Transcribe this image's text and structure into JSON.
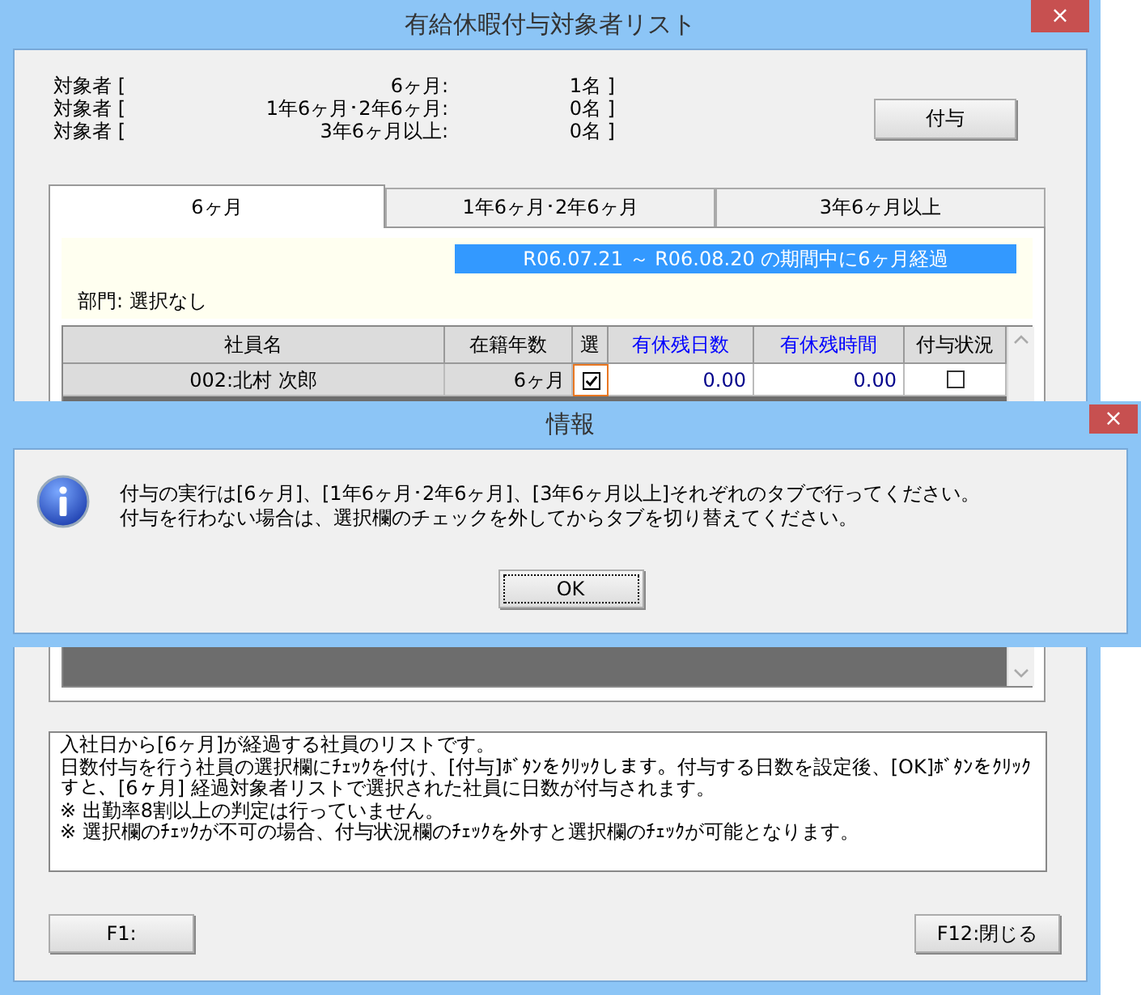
{
  "window": {
    "title": "有給休暇付与対象者リスト",
    "close": "×"
  },
  "summary": [
    {
      "prefix": "対象者 [",
      "label": "6ヶ月:",
      "count": "1名 ]"
    },
    {
      "prefix": "対象者 [",
      "label": "1年6ヶ月･2年6ヶ月:",
      "count": "0名 ]"
    },
    {
      "prefix": "対象者 [",
      "label": "3年6ヶ月以上:",
      "count": "0名 ]"
    }
  ],
  "grant_button": "付与",
  "tabs": [
    {
      "label": "6ヶ月",
      "selected": true
    },
    {
      "label": "1年6ヶ月･2年6ヶ月",
      "selected": false
    },
    {
      "label": "3年6ヶ月以上",
      "selected": false
    }
  ],
  "period_banner": "R06.07.21 ～ R06.08.20 の期間中に6ヶ月経過",
  "department": "部門:  選択なし",
  "table": {
    "columns": [
      {
        "label": "社員名",
        "color": "#000000"
      },
      {
        "label": "在籍年数",
        "color": "#000000"
      },
      {
        "label": "選",
        "color": "#000000"
      },
      {
        "label": "有休残日数",
        "color": "#0000ff"
      },
      {
        "label": "有休残時間",
        "color": "#0000ff"
      },
      {
        "label": "付与状況",
        "color": "#000000"
      }
    ],
    "rows": [
      {
        "name": "002:北村  次郎",
        "tenure": "6ヶ月",
        "checked": true,
        "focused": true,
        "days": "0.00",
        "hours": "0.00",
        "granted": false
      }
    ]
  },
  "description": [
    "入社日から[6ヶ月]が経過する社員のリストです。",
    "日数付与を行う社員の選択欄にﾁｪｯｸを付け、[付与]ﾎﾞﾀﾝをｸﾘｯｸします。付与する日数を設定後、[OK]ﾎﾞﾀﾝをｸﾘｯｸすと、[6ヶ月] 経過対象者リストで選択された社員に日数が付与されます。",
    "※ 出勤率8割以上の判定は行っていません。",
    "※ 選択欄のﾁｪｯｸが不可の場合、付与状況欄のﾁｪｯｸを外すと選択欄のﾁｪｯｸが可能となります。"
  ],
  "footer_buttons": [
    "F1:",
    "F12:閉じる"
  ],
  "dialog": {
    "title": "情報",
    "close": "×",
    "message": [
      "付与の実行は[6ヶ月]、[1年6ヶ月･2年6ヶ月]、[3年6ヶ月以上]それぞれのタブで行ってください。",
      "付与を行わない場合は、選択欄のチェックを外してからタブを切り替えてください。"
    ],
    "ok": "OK"
  }
}
